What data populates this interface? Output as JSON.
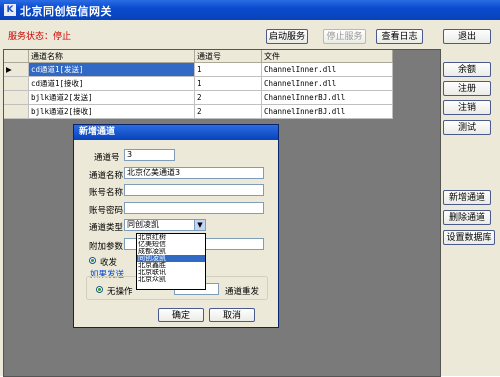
{
  "window": {
    "title": "北京同创短信网关",
    "icon": "app-icon"
  },
  "status": {
    "text": "服务状态：停止"
  },
  "toolbar": {
    "start": "启动服务",
    "stop": "停止服务",
    "log": "查看日志",
    "exit": "退出"
  },
  "side_buttons": {
    "balance": "余额",
    "register": "注册",
    "logout": "注销",
    "test": "测试",
    "add_channel": "新增通道",
    "delete_channel": "删除通道",
    "db_settings": "设置数据库"
  },
  "grid": {
    "columns": [
      "通道名称",
      "通道号",
      "文件"
    ],
    "rows": [
      {
        "name": "cd通道1[发送]",
        "number": "1",
        "file": "ChannelInner.dll",
        "selected": true
      },
      {
        "name": "cd通道1[接收]",
        "number": "1",
        "file": "ChannelInner.dll",
        "selected": false
      },
      {
        "name": "bjlk通道2[发送]",
        "number": "2",
        "file": "ChannelInnerBJ.dll",
        "selected": false
      },
      {
        "name": "bjlk通道2[接收]",
        "number": "2",
        "file": "ChannelInnerBJ.dll",
        "selected": false
      }
    ]
  },
  "dialog": {
    "title": "新增通道",
    "fields": {
      "channel_no_label": "通道号",
      "channel_no_value": "3",
      "channel_name_label": "通道名称",
      "channel_name_value": "北京亿美通道3",
      "account_name_label": "账号名称",
      "account_pwd_label": "账号密码",
      "channel_type_label": "通道类型",
      "channel_type_value": "同创凌凯",
      "extra_params_label": "附加参数"
    },
    "radio_receive": "收发",
    "hint_text": "如果发送",
    "radio_nonstop": "无操作",
    "redial_label": "通道重发",
    "ok": "确定",
    "cancel": "取消",
    "type_options": [
      "北京红树",
      "亿美短信",
      "成都凌凯",
      "同创凌凯",
      "北京鑫胜",
      "北京联讯",
      "北京众凯"
    ],
    "type_highlight_index": 3
  }
}
